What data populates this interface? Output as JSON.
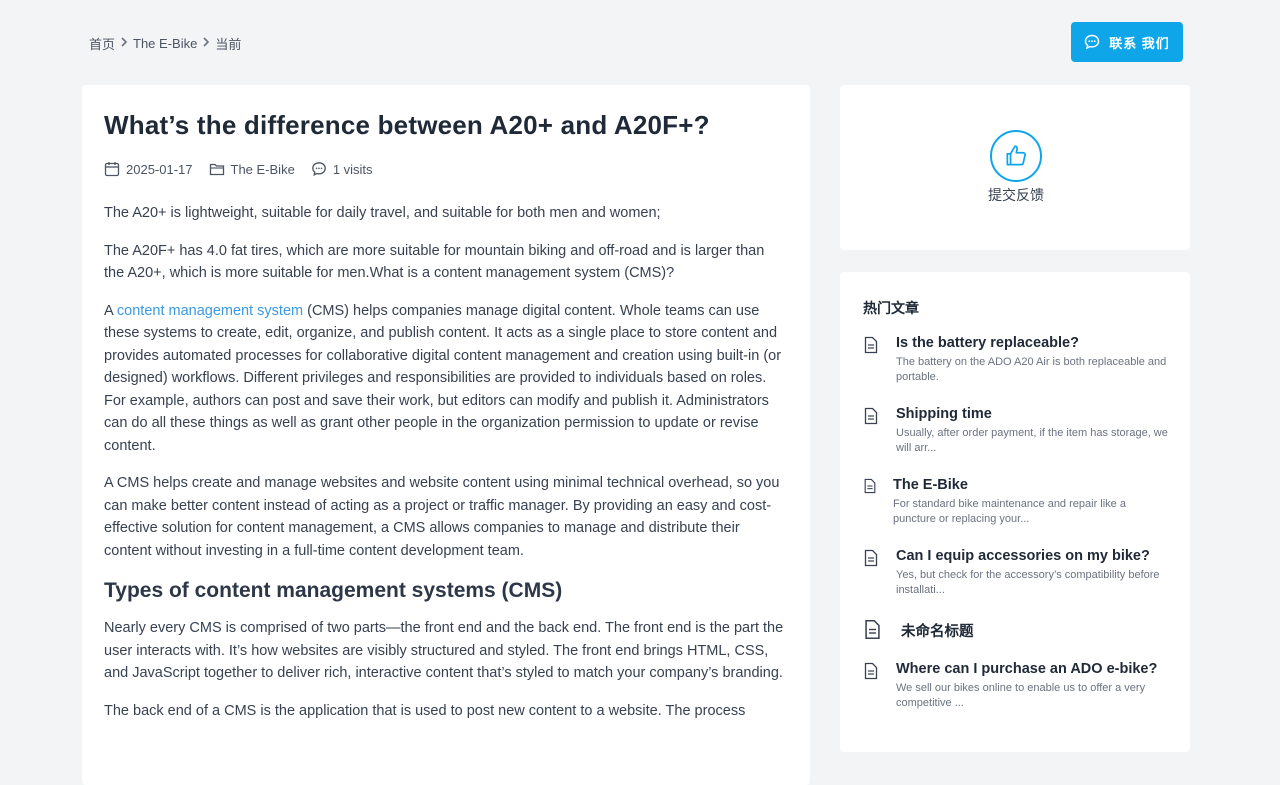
{
  "breadcrumb": [
    {
      "label": "首页"
    },
    {
      "label": "The E-Bike"
    },
    {
      "label": "当前"
    }
  ],
  "contact_button": {
    "label": "联系 我们",
    "icon": "chat-bubble-icon"
  },
  "article": {
    "title": "What’s the difference between A20+ and A20F+?",
    "meta": {
      "date": "2025-01-17",
      "category": "The E-Bike",
      "visits": "1 visits"
    },
    "p1": "The A20+ is lightweight, suitable for daily travel, and suitable for both men and women;",
    "p2": "The A20F+ has 4.0 fat tires, which are more suitable for mountain biking and off-road and is larger than the A20+, which is more suitable for men.What is a content management system (CMS)?",
    "p3_prefix": "A ",
    "p3_link": "content management system",
    "p3_rest": " (CMS) helps companies manage digital content. Whole teams can use these systems to create, edit, organize, and publish content. It acts as a single place to store content and provides automated processes for collaborative digital content management and creation using built-in (or designed) workflows. Different privileges and responsibilities are provided to individuals based on roles. For example, authors can post and save their work, but editors can modify and publish it. Administrators can do all these things as well as grant other people in the organization permission to update or revise content.",
    "p4": "A CMS helps create and manage websites and website content using minimal technical overhead, so you can make better content instead of acting as a project or traffic manager. By providing an easy and cost-effective solution for content management, a CMS allows companies to manage and distribute their content without investing in a full-time content development team.",
    "h2": "Types of content management systems (CMS)",
    "p5": "Nearly every CMS is comprised of two parts—the front end and the back end. The front end is the part the user interacts with. It’s how websites are visibly structured and styled. The front end brings HTML, CSS, and JavaScript together to deliver rich, interactive content that’s styled to match your company’s branding.",
    "p6": "The back end of a CMS is the application that is used to post new content to a website. The process"
  },
  "feedback": {
    "label": "提交反馈",
    "icon": "thumbs-up-icon"
  },
  "hot": {
    "title": "热门文章",
    "items": [
      {
        "title": "Is the battery replaceable?",
        "desc": "The battery on the ADO A20 Air is both replaceable and portable."
      },
      {
        "title": "Shipping time",
        "desc": "Usually, after order payment, if the item has storage, we will arr..."
      },
      {
        "title": "The E-Bike",
        "desc": "For standard bike maintenance and repair like a puncture or replacing your..."
      },
      {
        "title": "Can I equip accessories on my bike?",
        "desc": "Yes, but check for the accessory’s compatibility before installati..."
      },
      {
        "title": "未命名标题",
        "desc": ""
      },
      {
        "title": "Where can I purchase an ADO e-bike?",
        "desc": "We sell our bikes online to enable us to offer a very competitive ..."
      }
    ]
  },
  "colors": {
    "accent": "#0ea5e9",
    "link": "#3b9ae1",
    "background": "#f3f4f6"
  }
}
